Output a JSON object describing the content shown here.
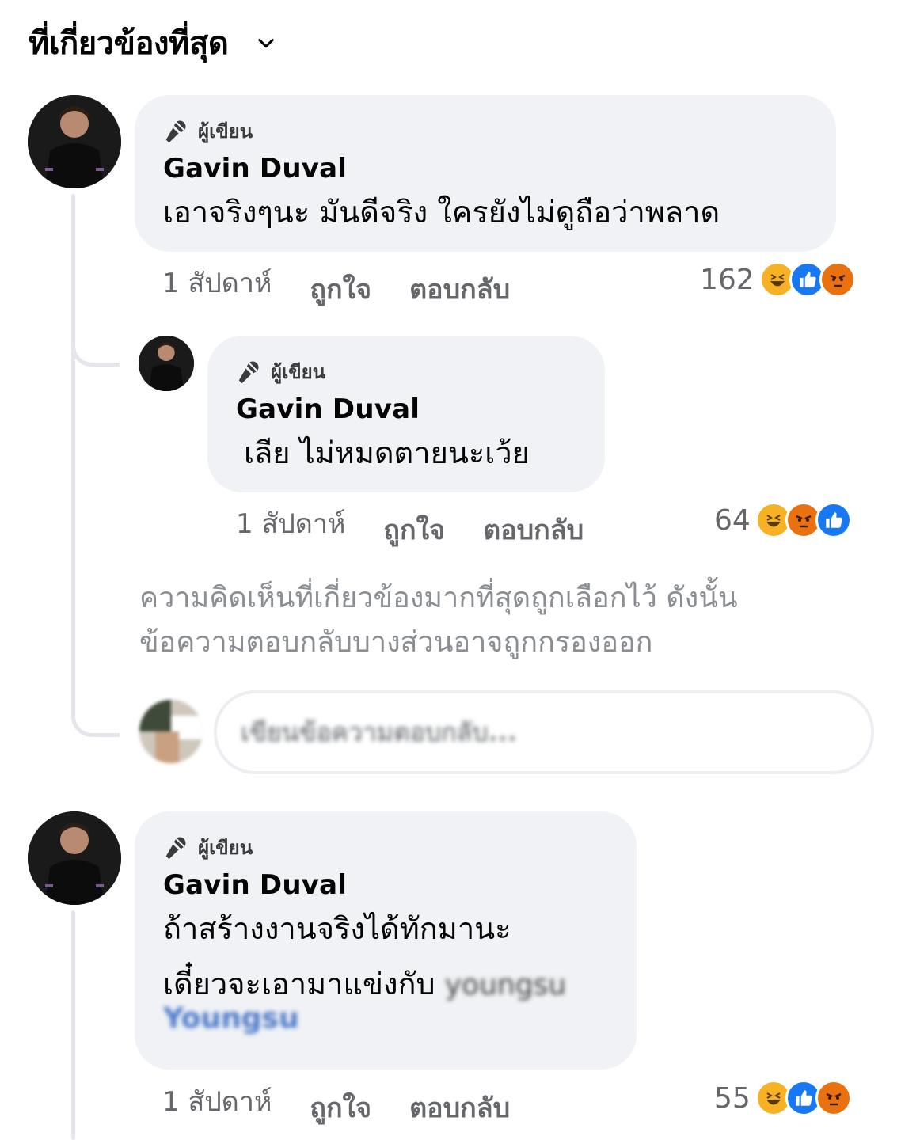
{
  "header": {
    "sort_label": "ที่เกี่ยวข้องที่สุด"
  },
  "comments": [
    {
      "badge": "ผู้เขียน",
      "author": "Gavin Duval",
      "text_lines": [
        "เอาจริงๆนะ มันดีจริง ใครยังไม่ดูถือว่าพลาด"
      ],
      "time": "1 สัปดาห์",
      "like": "ถูกใจ",
      "reply": "ตอบกลับ",
      "reaction_count": "162",
      "reactions": [
        "haha-icon",
        "like-icon",
        "angry-icon"
      ]
    },
    {
      "badge": "ผู้เขียน",
      "author": "Gavin Duval",
      "text_lines": [
        "เลีย ไม่หมดตายนะเว้ย"
      ],
      "time": "1 สัปดาห์",
      "like": "ถูกใจ",
      "reply": "ตอบกลับ",
      "reaction_count": "64",
      "reactions": [
        "haha-icon",
        "angry-icon",
        "like-icon"
      ]
    },
    {
      "badge": "ผู้เขียน",
      "author": "Gavin Duval",
      "text_lines": [
        "ถ้าสร้างงานจริงได้ทักมานะ",
        "เดี๋ยวจะเอามาแข่งกับ"
      ],
      "mention_blurred": "youngsu",
      "mention_link_blurred": "Youngsu",
      "time": "1 สัปดาห์",
      "like": "ถูกใจ",
      "reply": "ตอบกลับ",
      "reaction_count": "55",
      "reactions": [
        "haha-icon",
        "like-icon",
        "angry-icon"
      ]
    }
  ],
  "notice_lines": [
    "ความคิดเห็นที่เกี่ยวข้องมากที่สุดถูกเลือกไว้ ดังนั้น",
    "ข้อความตอบกลับบางส่วนอาจถูกกรองออก"
  ],
  "reply_box": {
    "placeholder": "เขียนข้อความตอบกลับ..."
  },
  "colors": {
    "like": "#1877f2",
    "haha": "#f7b125",
    "angry": "#e9710f",
    "bubble": "#f0f2f5",
    "muted": "#65676b"
  }
}
